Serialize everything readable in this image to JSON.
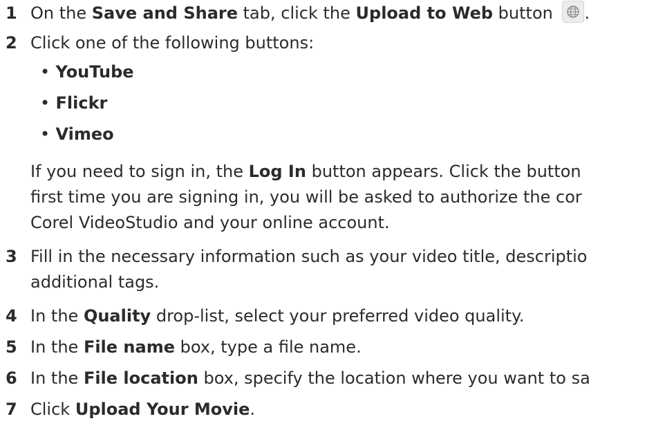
{
  "steps": [
    {
      "num": "1",
      "t1": "On the ",
      "b1": "Save and Share",
      "t2": " tab, click the ",
      "b2": "Upload to Web",
      "t3": " button ",
      "t4": "."
    },
    {
      "num": "2",
      "t1": "Click one of the following buttons:"
    },
    {
      "num": "3",
      "line1": "Fill in the necessary information such as your video title, descriptio",
      "line2": "additional tags."
    },
    {
      "num": "4",
      "t1": "In the ",
      "b1": "Quality",
      "t2": " drop-list, select your preferred video quality."
    },
    {
      "num": "5",
      "t1": "In the ",
      "b1": "File name",
      "t2": " box, type a file name."
    },
    {
      "num": "6",
      "t1": "In the ",
      "b1": "File location",
      "t2": " box, specify the location where you want to sa"
    },
    {
      "num": "7",
      "t1": "Click ",
      "b1": "Upload Your Movie",
      "t2": "."
    }
  ],
  "bullets": [
    "YouTube",
    "Flickr",
    "Vimeo"
  ],
  "bullet_char": "•",
  "note": {
    "l1a": "If you need to sign in, the ",
    "l1b": "Log In",
    "l1c": " button appears. Click the button",
    "l2": "first time you are signing in, you will be asked to authorize the cor",
    "l3": "Corel VideoStudio and your online account."
  },
  "icons": {
    "upload_to_web": "globe-icon"
  }
}
